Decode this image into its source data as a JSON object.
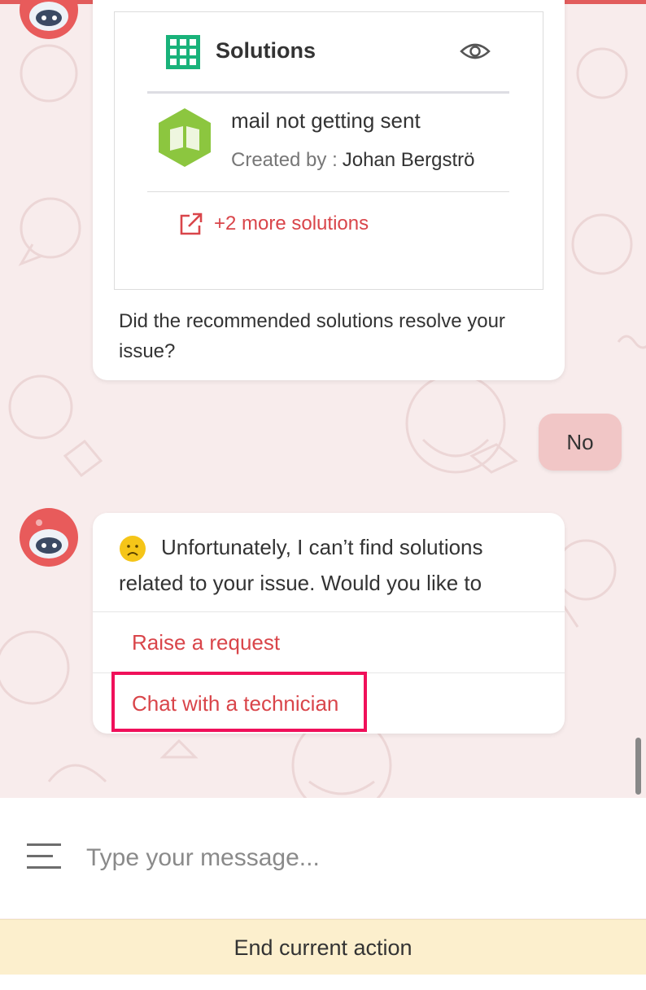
{
  "solutions_card": {
    "title": "Solutions",
    "item_title": "mail not getting sent",
    "created_by_label": "Created by :",
    "created_by_name": "Johan Bergströ",
    "more_link": "+2 more solutions"
  },
  "bot_question": "Did the recommended solutions resolve your issue?",
  "user_reply": "No",
  "bot_reply": {
    "message": "Unfortunately, I can’t find solutions related to your issue. Would you like to",
    "options": [
      "Raise a request",
      "Chat with a technician"
    ]
  },
  "composer": {
    "placeholder": "Type your message..."
  },
  "end_action": "End current action",
  "colors": {
    "accent_red": "#d9454a",
    "user_bubble": "#f1c6c6",
    "highlight": "#f0105a",
    "grid_icon_green": "#19b27a",
    "book_hex_green": "#8cc63f",
    "end_bar_bg": "#fcefcd"
  },
  "icons": [
    "robot-avatar-icon",
    "grid-icon",
    "eye-icon",
    "book-hexagon-icon",
    "external-link-icon",
    "sad-face-icon",
    "menu-icon"
  ]
}
